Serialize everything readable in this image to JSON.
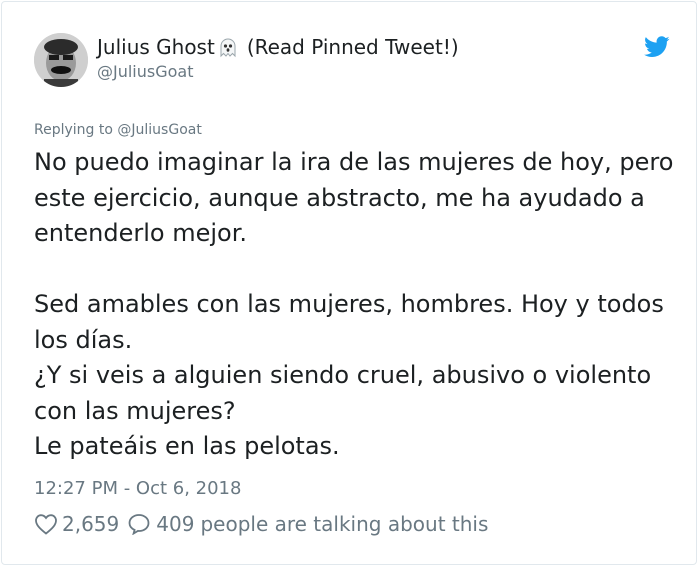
{
  "tweet": {
    "author": {
      "display_name": "Julius Ghost",
      "name_suffix": "(Read Pinned Tweet!)",
      "handle": "@JuliusGoat"
    },
    "replying": {
      "prefix": "Replying to",
      "handle": "@JuliusGoat"
    },
    "text": "No puedo imaginar la ira de las mujeres de hoy, pero\neste ejercicio, aunque abstracto, me ha ayudado a\nentenderlo mejor.\n\nSed amables con las mujeres, hombres. Hoy y todos\nlos días.\n¿Y si veis a alguien siendo cruel, abusivo o violento\ncon las mujeres?\nLe pateáis en las pelotas.",
    "timestamp": "12:27 PM - Oct 6, 2018",
    "likes": "2,659",
    "replies": "409",
    "talking_label": "people are talking about this"
  },
  "icons": {
    "ghost": "ghost-emoji-icon",
    "brand": "twitter-bird-icon",
    "like": "heart-icon",
    "reply": "speech-bubble-icon"
  },
  "colors": {
    "text": "#1c2022",
    "secondary": "#697882",
    "brand": "#1da1f2",
    "border": "#e1e8ed"
  }
}
